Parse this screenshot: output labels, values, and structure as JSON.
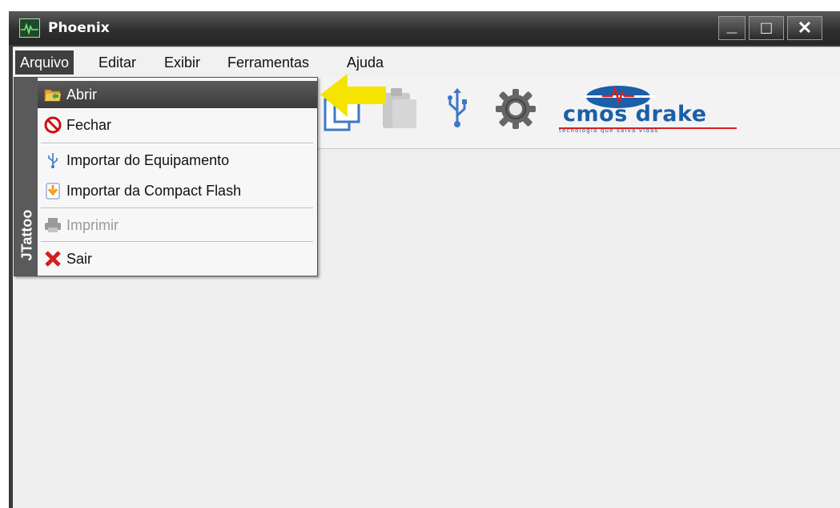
{
  "window": {
    "title": "Phoenix",
    "app_icon": "heartbeat-monitor-icon",
    "controls": [
      {
        "name": "minimize",
        "glyph": "_"
      },
      {
        "name": "maximize",
        "glyph": "□"
      },
      {
        "name": "close",
        "glyph": "✕"
      }
    ]
  },
  "menubar": {
    "items": [
      {
        "label": "Arquivo",
        "active": true
      },
      {
        "label": "Editar"
      },
      {
        "label": "Exibir"
      },
      {
        "label": "Ferramentas"
      },
      {
        "label": "Ajuda"
      }
    ]
  },
  "dropdown": {
    "side_label": "JTattoo",
    "items": [
      {
        "label": "Abrir",
        "icon": "open-folder-icon",
        "highlighted": true,
        "enabled": true
      },
      {
        "label": "Fechar",
        "icon": "no-entry-icon",
        "enabled": true
      },
      {
        "label": "Importar do Equipamento",
        "icon": "usb-icon",
        "enabled": true
      },
      {
        "label": "Importar da Compact Flash",
        "icon": "import-card-icon",
        "enabled": true
      },
      {
        "label": "Imprimir",
        "icon": "printer-icon",
        "enabled": false
      },
      {
        "label": "Sair",
        "icon": "red-x-icon",
        "enabled": true
      }
    ]
  },
  "toolbar": {
    "icons": [
      "new-document-icon",
      "paste-icon",
      "usb-icon",
      "settings-gear-icon"
    ]
  },
  "logo": {
    "text": "cmos drake",
    "tagline": "tecnologia que salva vidas",
    "brand_color": "#1a5fa8",
    "accent_color": "#d62020"
  },
  "annotation": {
    "icon": "yellow-arrow-icon",
    "color": "#f5e400"
  }
}
